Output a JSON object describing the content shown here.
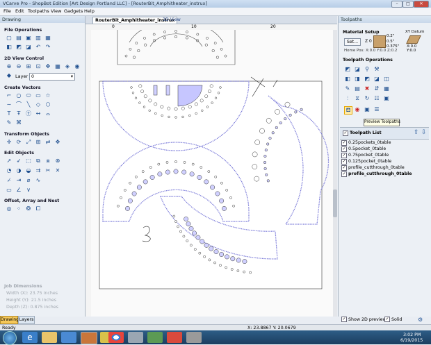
{
  "window": {
    "title": "VCarve Pro - ShopBot Edition [Art Design Portland LLC] - [RouterBit_Amphitheater_instrux]"
  },
  "menu": [
    "File",
    "Edit",
    "Toolpaths",
    "View",
    "Gadgets",
    "Help"
  ],
  "left": {
    "header": "Drawing",
    "sections": [
      "File Operations",
      "2D View Control",
      "Create Vectors",
      "Transform Objects",
      "Edit Objects",
      "Offset, Array and Nest"
    ],
    "layer_label": "Layer",
    "layer_value": "0",
    "job": {
      "title": "Job Dimensions",
      "width": "Width  (X): 23.75 inches",
      "height": "Height (Y): 21.5 inches",
      "depth": "Depth  (Z): 0.875 inches"
    },
    "tabs": [
      "Drawing",
      "Layers"
    ]
  },
  "doc_tabs": [
    "RouterBit_Amphitheater_instrux",
    "3D View"
  ],
  "ruler": {
    "ticks": [
      "0",
      "10",
      "20"
    ]
  },
  "right": {
    "header": "Toolpaths",
    "material_setup": "Material Setup",
    "set_button": "Set...",
    "z_label": "Z 0",
    "offsets": [
      "0.2\"",
      "0.5\"",
      "0.375\""
    ],
    "home_pos": "Home Pos:   X:0.0 Y:0.0 Z:0.2",
    "xy_datum": "XY Datum",
    "datum_values": [
      "X:0.0",
      "Y:0.0"
    ],
    "ops_title": "Toolpath Operations",
    "tooltip": "Preview Toolpaths",
    "list_title": "Toolpath List",
    "toolpaths": [
      "0.25pockets_0table",
      "0.5pocket_0table",
      "0.75pocket_0table",
      "0.125pocket_0table",
      "profile_cutthrough_0table",
      "profile_cutthrough_0table"
    ],
    "show_2d": "Show 2D previews",
    "solid": "Solid"
  },
  "status": {
    "left": "Ready",
    "coords": "X: 23.8867 Y: 20.0679"
  },
  "taskbar": {
    "time": "3:02 PM",
    "date": "6/19/2015"
  },
  "colors": {
    "accent": "#7878d8",
    "highlight": "#c6c6ff",
    "titlebar": "#b7cde6"
  }
}
